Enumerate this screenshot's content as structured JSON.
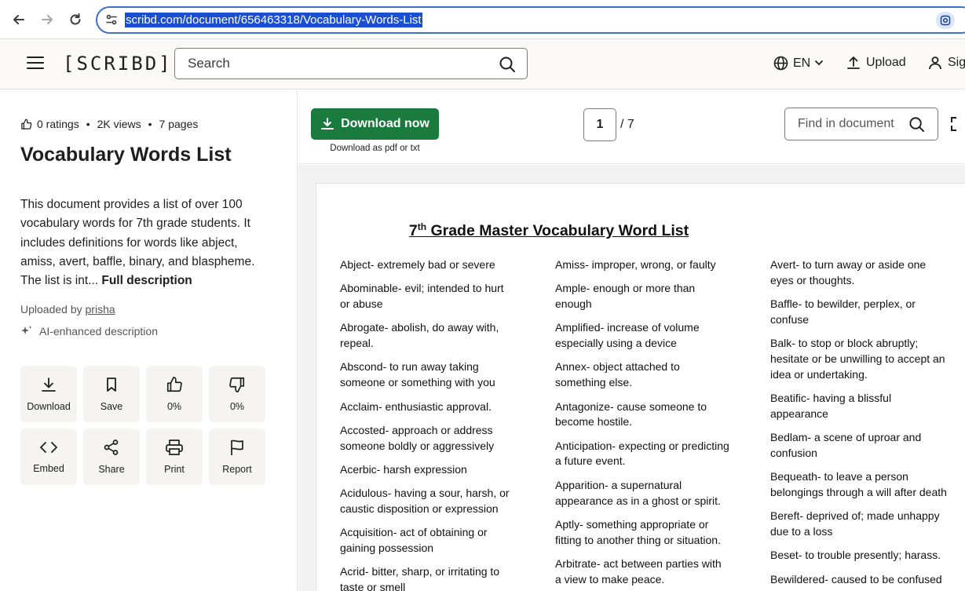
{
  "browser": {
    "url": "scribd.com/document/656463318/Vocabulary-Words-List"
  },
  "header": {
    "logo": "[SCRIBD]",
    "search_placeholder": "Search",
    "language": "EN",
    "upload_label": "Upload",
    "signin_label": "Sig"
  },
  "sidebar": {
    "ratings": "0 ratings",
    "views": "2K views",
    "pages": "7 pages",
    "title": "Vocabulary Words List",
    "description": "This document provides a list of over 100 vocabulary words for 7th grade students. It includes definitions for words like abject, amiss, avert, baffle, binary, and blaspheme. The list is int...",
    "full_description_label": "Full description",
    "uploaded_by_label": "Uploaded by",
    "uploader": "prisha",
    "ai_label": "AI-enhanced description",
    "actions": [
      {
        "label": "Download",
        "icon": "download-icon"
      },
      {
        "label": "Save",
        "icon": "bookmark-icon"
      },
      {
        "label": "0%",
        "icon": "thumbs-up-icon"
      },
      {
        "label": "0%",
        "icon": "thumbs-down-icon"
      },
      {
        "label": "Embed",
        "icon": "code-icon"
      },
      {
        "label": "Share",
        "icon": "share-icon"
      },
      {
        "label": "Print",
        "icon": "printer-icon"
      },
      {
        "label": "Report",
        "icon": "flag-icon"
      }
    ]
  },
  "toolbar": {
    "download_label": "Download now",
    "download_sub": "Download as pdf or txt",
    "current_page": "1",
    "total_pages": "/ 7",
    "find_placeholder": "Find in document"
  },
  "document": {
    "heading_prefix": "7",
    "heading_sup": "th",
    "heading_rest": " Grade Master Vocabulary Word List",
    "columns": [
      [
        "Abject- extremely bad or severe",
        "Abominable- evil; intended to hurt or abuse",
        "Abrogate- abolish, do away with, repeal.",
        "Abscond- to run away taking someone or something with you",
        "Acclaim- enthusiastic approval.",
        "Accosted- approach or address someone boldly or aggressively",
        "Acerbic- harsh expression",
        "Acidulous- having a sour, harsh, or caustic disposition or expression",
        "Acquisition- act of obtaining or gaining possession",
        "Acrid- bitter, sharp, or irritating to taste or smell"
      ],
      [
        "Amiss- improper, wrong, or faulty",
        "Ample- enough or more than enough",
        "Amplified- increase of volume especially using a device",
        "Annex- object attached to something else.",
        "Antagonize- cause someone to become hostile.",
        "Anticipation- expecting or predicting a future event.",
        "Apparition- a supernatural appearance as in a ghost or spirit.",
        "Aptly- something appropriate or fitting to another thing or situation.",
        "Arbitrate- act between parties with a view to make peace."
      ],
      [
        "Avert- to turn away or aside one eyes or thoughts.",
        "Baffle- to bewilder, perplex, or confuse",
        "Balk- to stop or block abruptly; hesitate or be unwilling to accept an idea or undertaking.",
        "Beatific- having a blissful appearance",
        "Bedlam- a scene of uproar and confusion",
        "Bequeath- to leave a person belongings through a will after death",
        "Bereft- deprived of; made unhappy due to a loss",
        "Beset- to trouble presently; harass.",
        "Bewildered- caused to be confused emotionally"
      ]
    ]
  }
}
